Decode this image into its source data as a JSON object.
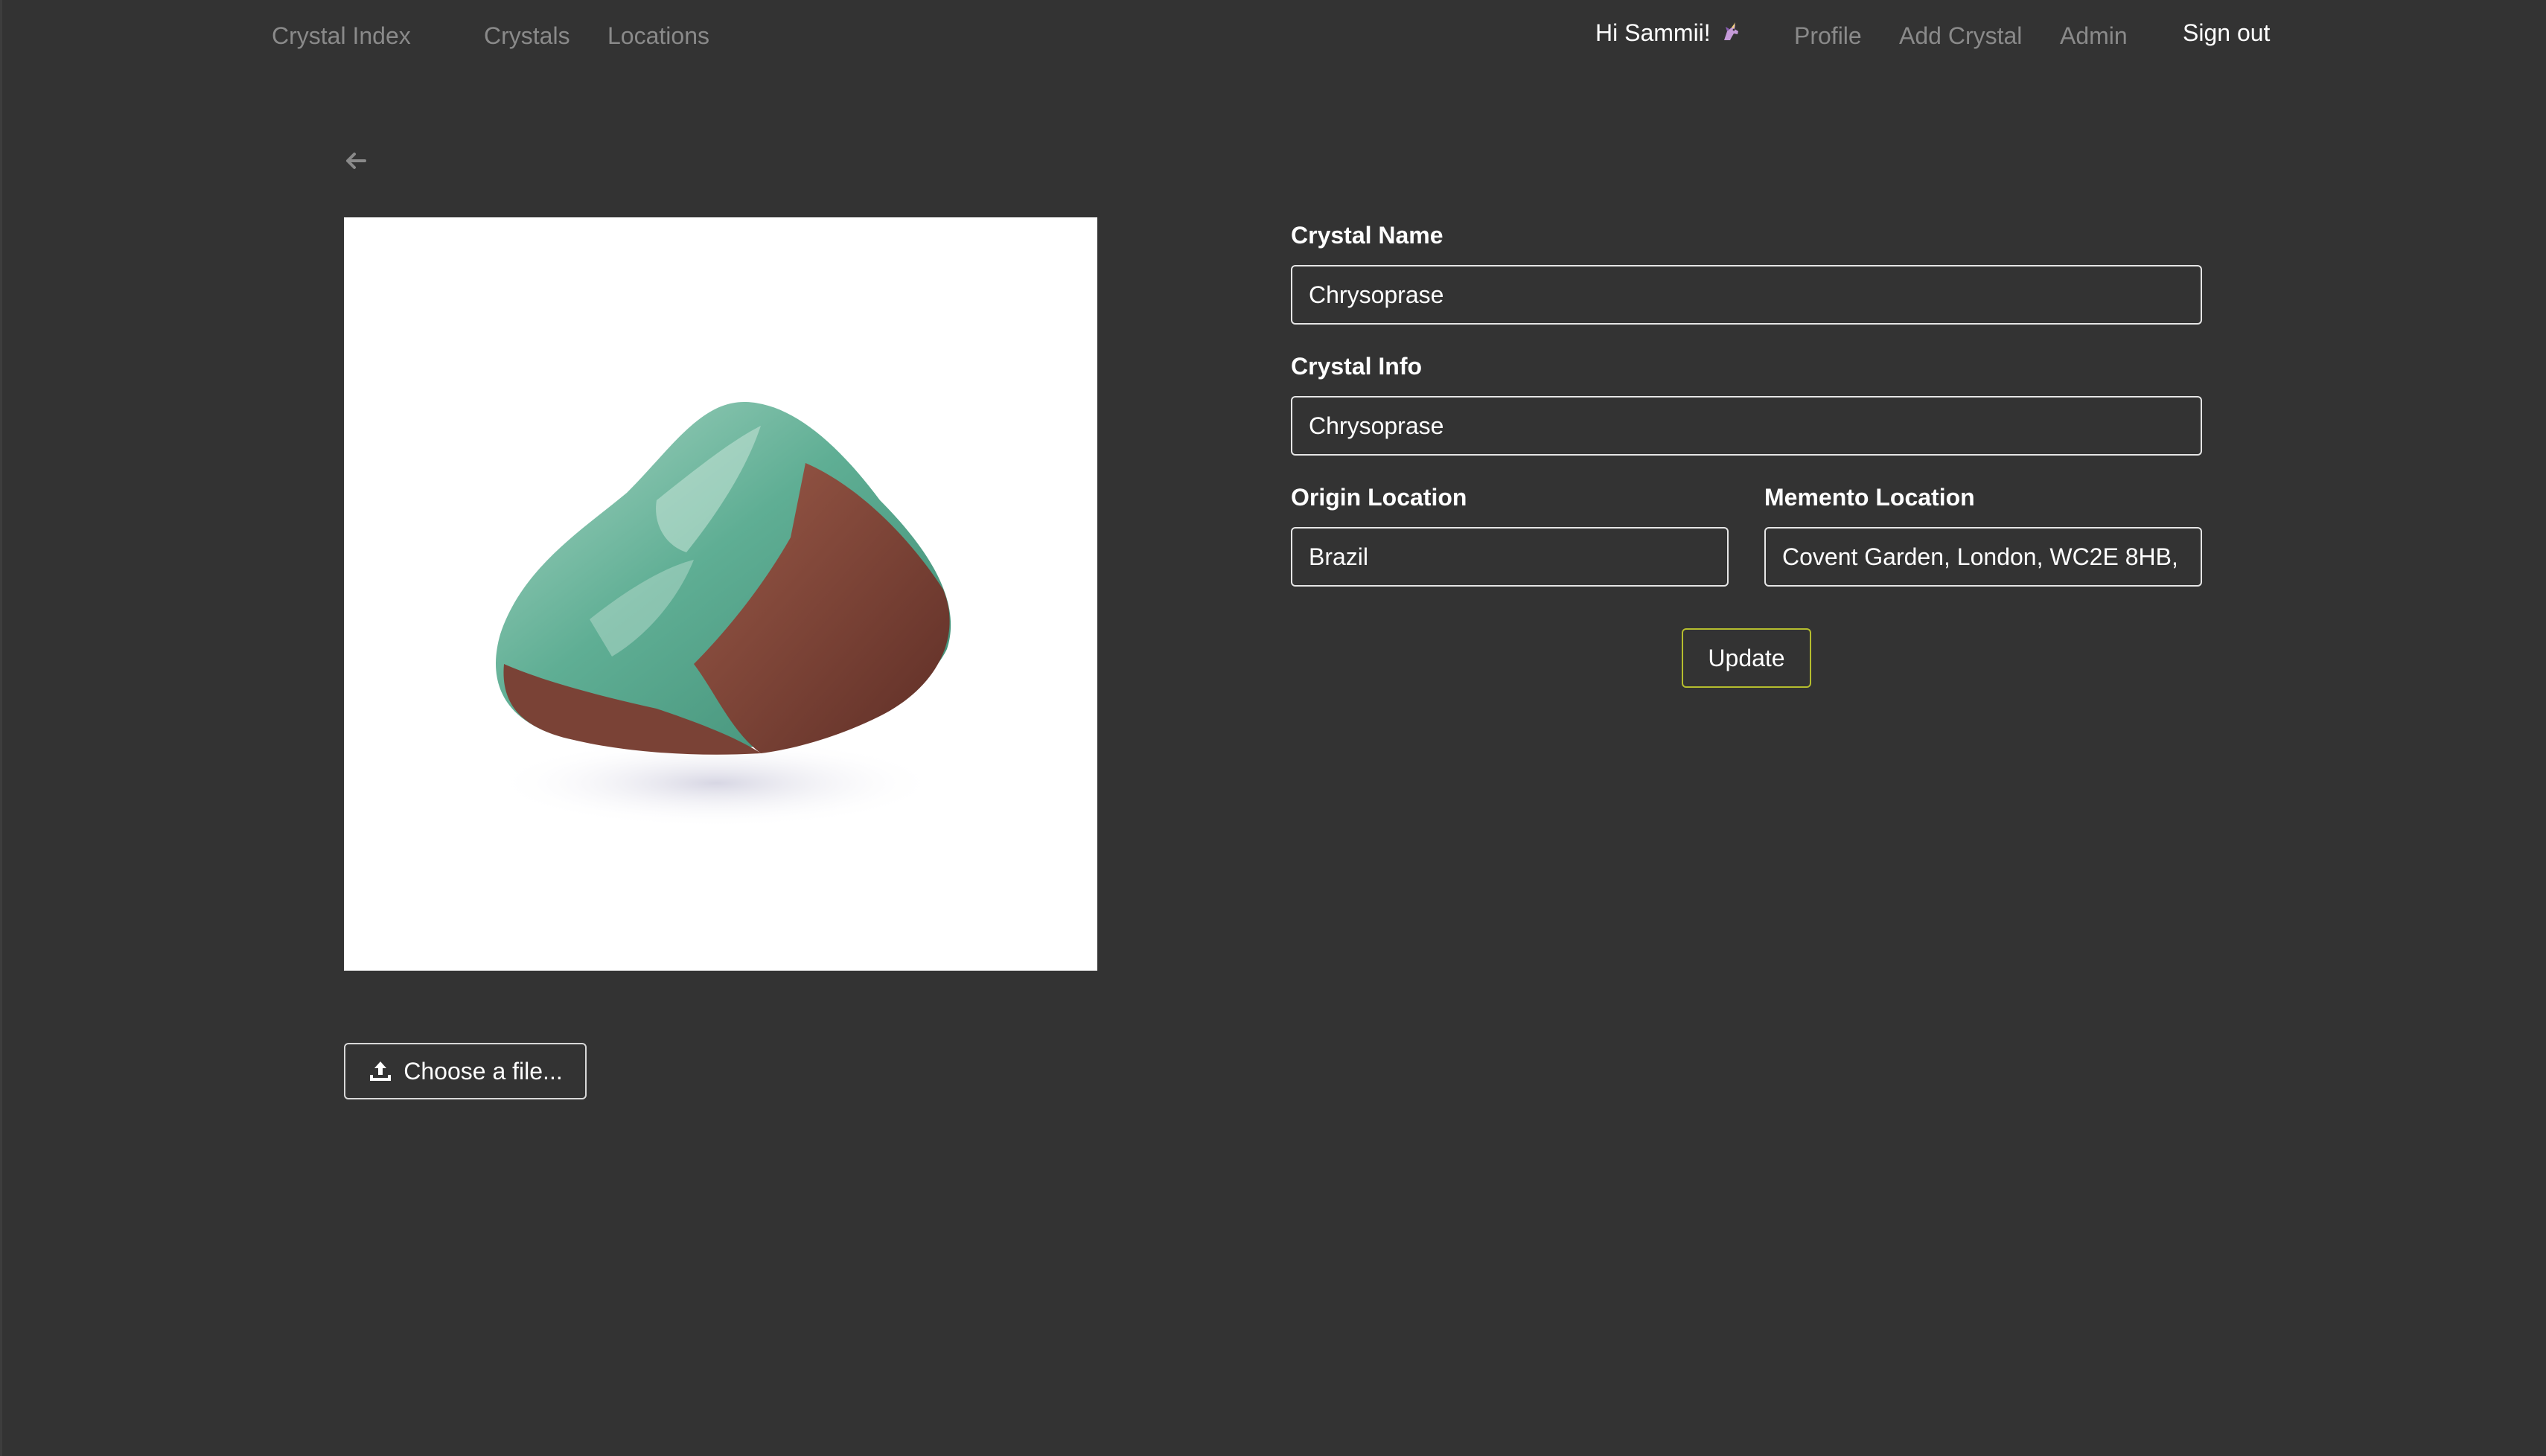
{
  "nav": {
    "brand": "Crystal Index",
    "links": [
      "Crystals",
      "Locations"
    ],
    "greeting": "Hi Sammii!",
    "greeting_icon": "unicorn-icon",
    "user_links": [
      "Profile",
      "Add Crystal",
      "Admin"
    ],
    "signout": "Sign out"
  },
  "back_icon": "arrow-left-icon",
  "image": {
    "subject": "Chrysoprase tumbled stone",
    "upload_label": "Choose a file...",
    "upload_icon": "upload-icon"
  },
  "form": {
    "crystal_name_label": "Crystal Name",
    "crystal_name_value": "Chrysoprase",
    "crystal_info_label": "Crystal Info",
    "crystal_info_value": "Chrysoprase",
    "origin_label": "Origin Location",
    "origin_value": "Brazil",
    "memento_label": "Memento Location",
    "memento_value": "Covent Garden, London, WC2E 8HB,",
    "submit_label": "Update"
  },
  "colors": {
    "background": "#333333",
    "nav_link": "#8a8a8a",
    "submit_border": "#b5bd2e"
  }
}
